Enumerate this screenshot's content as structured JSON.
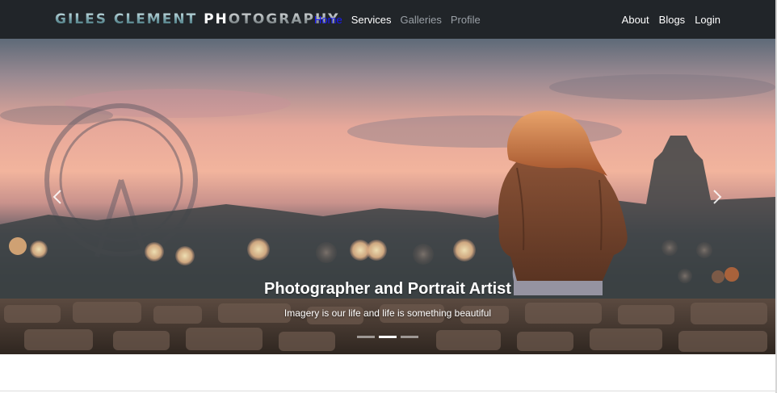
{
  "brand": {
    "part1": "Giles Clement",
    "part2": "Ph",
    "part3": "otography"
  },
  "nav_left": [
    "Home",
    "Services",
    "Galleries",
    "Profile"
  ],
  "nav_right": [
    "About",
    "Blogs",
    "Login"
  ],
  "carousel": {
    "title": "Photographer and Portrait Artist",
    "text": "Imagery is our life and life is something beautiful",
    "slide_count": 3,
    "active_slide": 2,
    "prev_icon": "chevron-left-icon",
    "next_icon": "chevron-right-icon"
  },
  "colors": {
    "navbar_bg": "#212529",
    "active_link": "#1a1aff",
    "muted_link": "#9aa0a6"
  }
}
